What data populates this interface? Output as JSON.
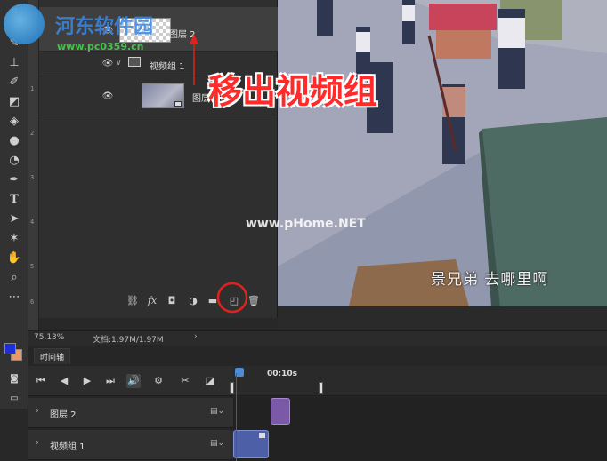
{
  "watermark": {
    "site_name": "河东软件园",
    "site_url": "www.pc0359.cn"
  },
  "layers_panel": {
    "layers": [
      {
        "name": "图层 2",
        "visible": true,
        "selected": true
      },
      {
        "name": "视频组 1",
        "visible": true,
        "is_group": true
      },
      {
        "name": "图层 1",
        "visible": true
      }
    ],
    "bottom_icons": [
      "link-icon",
      "fx-icon",
      "mask-icon",
      "adjustment-icon",
      "folder-icon",
      "new-layer-icon",
      "trash-icon"
    ],
    "fx_label": "fx"
  },
  "annotation": {
    "callout_text": "移出视频组",
    "highlight_color": "#e0221e"
  },
  "canvas": {
    "subtitle": "景兄弟  去哪里啊",
    "watermark": "www.pHome.NET"
  },
  "status_bar": {
    "zoom": "75.13%",
    "doc_info": "文档:1.97M/1.97M"
  },
  "timeline": {
    "tab_label": "时间轴",
    "time_marker": "00:10s",
    "tracks": [
      {
        "name": "图层 2"
      },
      {
        "name": "视频组 1"
      }
    ]
  },
  "ruler": {
    "ticks": [
      "1",
      "2",
      "3",
      "4",
      "5",
      "6"
    ]
  },
  "colors": {
    "foreground": "#1f2fd8",
    "background": "#e89a6a",
    "clip_layer2": "#7a5aa8",
    "clip_video": "#4d5fa6",
    "playhead": "#e0221e"
  }
}
